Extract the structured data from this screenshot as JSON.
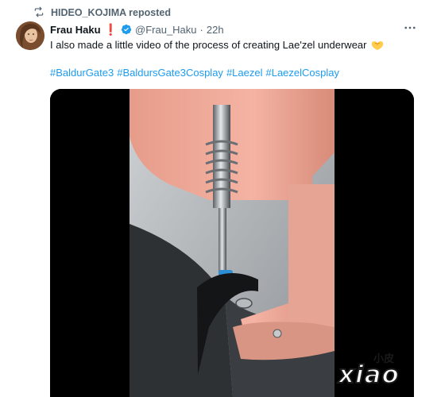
{
  "repost": {
    "label": "HIDEO_KOJIMA reposted"
  },
  "tweet": {
    "display_name": "Frau Haku",
    "name_badge": "❗",
    "handle": "@Frau_Haku",
    "separator": "·",
    "time": "22h",
    "text": "I also made a little video of the process of creating Lae'zel underwear",
    "hashtags": [
      "#BaldurGate3",
      "#BaldursGate3Cosplay",
      "#Laezel",
      "#LaezelCosplay"
    ]
  },
  "watermark": {
    "cn": "小皮",
    "main": "xiao"
  },
  "colors": {
    "link": "#1d9bf0",
    "secondary": "#536471",
    "badge": "#e0245e",
    "verified": "#1d9bf0"
  },
  "icons": {
    "repost": "repost-icon",
    "verified": "verified-badge-icon",
    "more": "more-icon",
    "emoji": "heart-hands-emoji"
  }
}
